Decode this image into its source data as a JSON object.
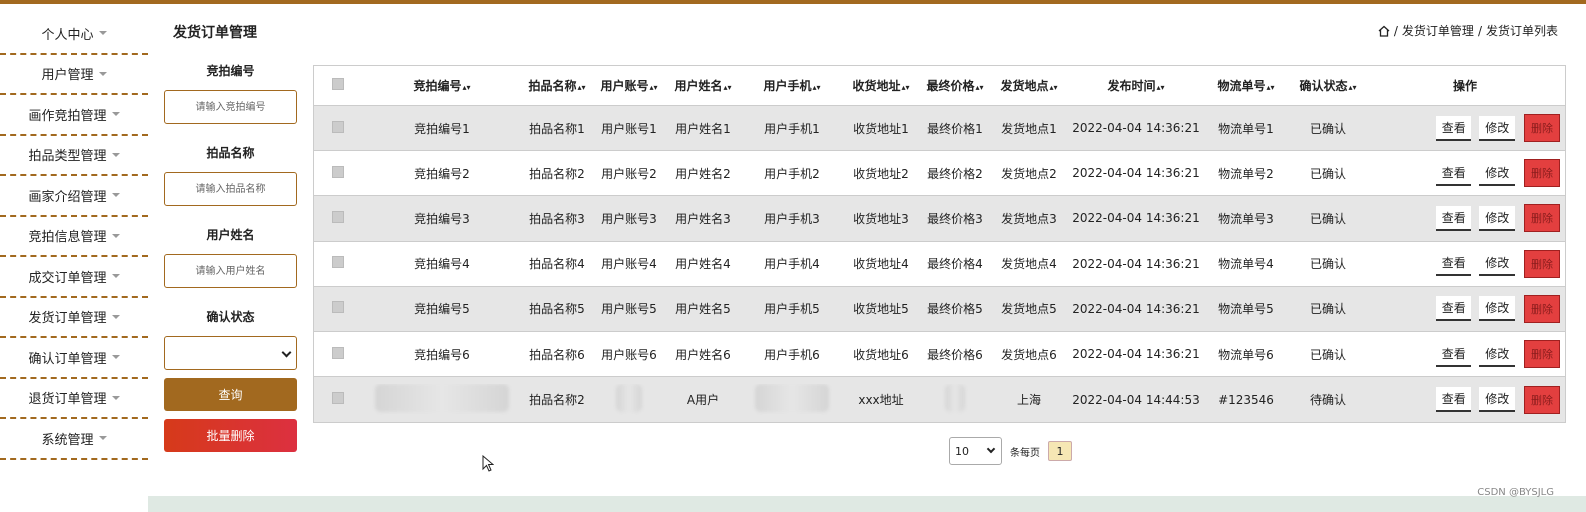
{
  "sidebar": {
    "items": [
      {
        "label": "个人中心"
      },
      {
        "label": "用户管理"
      },
      {
        "label": "画作竞拍管理"
      },
      {
        "label": "拍品类型管理"
      },
      {
        "label": "画家介绍管理"
      },
      {
        "label": "竞拍信息管理"
      },
      {
        "label": "成交订单管理"
      },
      {
        "label": "发货订单管理"
      },
      {
        "label": "确认订单管理"
      },
      {
        "label": "退货订单管理"
      },
      {
        "label": "系统管理"
      }
    ]
  },
  "header": {
    "title": "发货订单管理",
    "breadcrumb": [
      "发货订单管理",
      "发货订单列表"
    ],
    "separator": "/"
  },
  "search": {
    "fields": [
      {
        "label": "竞拍编号",
        "placeholder": "请输入竞拍编号"
      },
      {
        "label": "拍品名称",
        "placeholder": "请输入拍品名称"
      },
      {
        "label": "用户姓名",
        "placeholder": "请输入用户姓名"
      }
    ],
    "status_label": "确认状态",
    "status_value": "",
    "query_label": "查询",
    "batch_delete_label": "批量删除"
  },
  "table": {
    "columns": [
      "竞拍编号",
      "拍品名称",
      "用户账号",
      "用户姓名",
      "用户手机",
      "收货地址",
      "最终价格",
      "发货地点",
      "发布时间",
      "物流单号",
      "确认状态",
      "操作"
    ],
    "rows": [
      [
        "竞拍编号1",
        "拍品名称1",
        "用户账号1",
        "用户姓名1",
        "用户手机1",
        "收货地址1",
        "最终价格1",
        "发货地点1",
        "2022-04-04 14:36:21",
        "物流单号1",
        "已确认"
      ],
      [
        "竞拍编号2",
        "拍品名称2",
        "用户账号2",
        "用户姓名2",
        "用户手机2",
        "收货地址2",
        "最终价格2",
        "发货地点2",
        "2022-04-04 14:36:21",
        "物流单号2",
        "已确认"
      ],
      [
        "竞拍编号3",
        "拍品名称3",
        "用户账号3",
        "用户姓名3",
        "用户手机3",
        "收货地址3",
        "最终价格3",
        "发货地点3",
        "2022-04-04 14:36:21",
        "物流单号3",
        "已确认"
      ],
      [
        "竞拍编号4",
        "拍品名称4",
        "用户账号4",
        "用户姓名4",
        "用户手机4",
        "收货地址4",
        "最终价格4",
        "发货地点4",
        "2022-04-04 14:36:21",
        "物流单号4",
        "已确认"
      ],
      [
        "竞拍编号5",
        "拍品名称5",
        "用户账号5",
        "用户姓名5",
        "用户手机5",
        "收货地址5",
        "最终价格5",
        "发货地点5",
        "2022-04-04 14:36:21",
        "物流单号5",
        "已确认"
      ],
      [
        "竞拍编号6",
        "拍品名称6",
        "用户账号6",
        "用户姓名6",
        "用户手机6",
        "收货地址6",
        "最终价格6",
        "发货地点6",
        "2022-04-04 14:36:21",
        "物流单号6",
        "已确认"
      ],
      [
        "",
        "拍品名称2",
        "",
        "A用户",
        "",
        "xxx地址",
        "",
        "上海",
        "2022-04-04 14:44:53",
        "#123546",
        "待确认"
      ]
    ],
    "actions": {
      "view": "查看",
      "edit": "修改",
      "delete": "删除"
    }
  },
  "pagination": {
    "page_size": "10",
    "per_page_label": "条每页",
    "current_page": "1"
  },
  "watermark": "CSDN @BYSJLG",
  "colors": {
    "accent": "#a2691f",
    "danger": "#e33f3f"
  }
}
